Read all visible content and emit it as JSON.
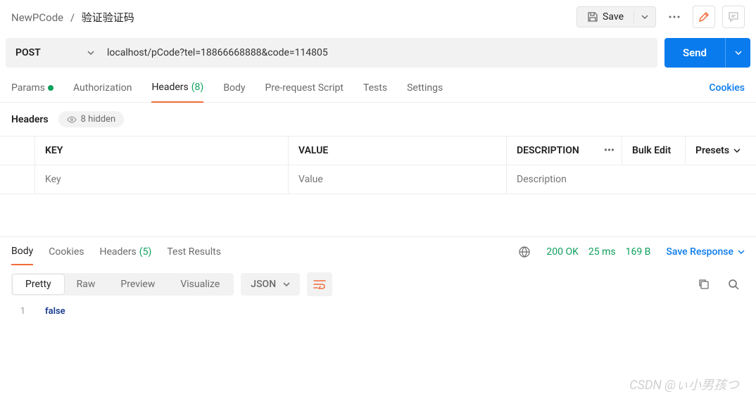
{
  "breadcrumb": {
    "parent": "NewPCode",
    "current": "验证验证码"
  },
  "toolbar": {
    "save": "Save"
  },
  "request": {
    "method": "POST",
    "url": "localhost/pCode?tel=18866668888&code=114805",
    "send": "Send"
  },
  "tabs": {
    "params": "Params",
    "auth": "Authorization",
    "headers": "Headers",
    "headers_count": "(8)",
    "body": "Body",
    "prerequest": "Pre-request Script",
    "tests": "Tests",
    "settings": "Settings",
    "cookies": "Cookies"
  },
  "headers_section": {
    "label": "Headers",
    "hidden": "8 hidden",
    "key_hdr": "KEY",
    "val_hdr": "VALUE",
    "desc_hdr": "DESCRIPTION",
    "bulk": "Bulk Edit",
    "presets": "Presets",
    "key_ph": "Key",
    "val_ph": "Value",
    "desc_ph": "Description"
  },
  "response": {
    "tabs": {
      "body": "Body",
      "cookies": "Cookies",
      "headers": "Headers",
      "headers_count": "(5)",
      "tests": "Test Results"
    },
    "status": "200 OK",
    "time": "25 ms",
    "size": "169 B",
    "save": "Save Response",
    "views": {
      "pretty": "Pretty",
      "raw": "Raw",
      "preview": "Preview",
      "visualize": "Visualize"
    },
    "format": "JSON",
    "line_no": "1",
    "body_text": "false"
  },
  "watermark": "CSDN @ぃ小男孩つ"
}
